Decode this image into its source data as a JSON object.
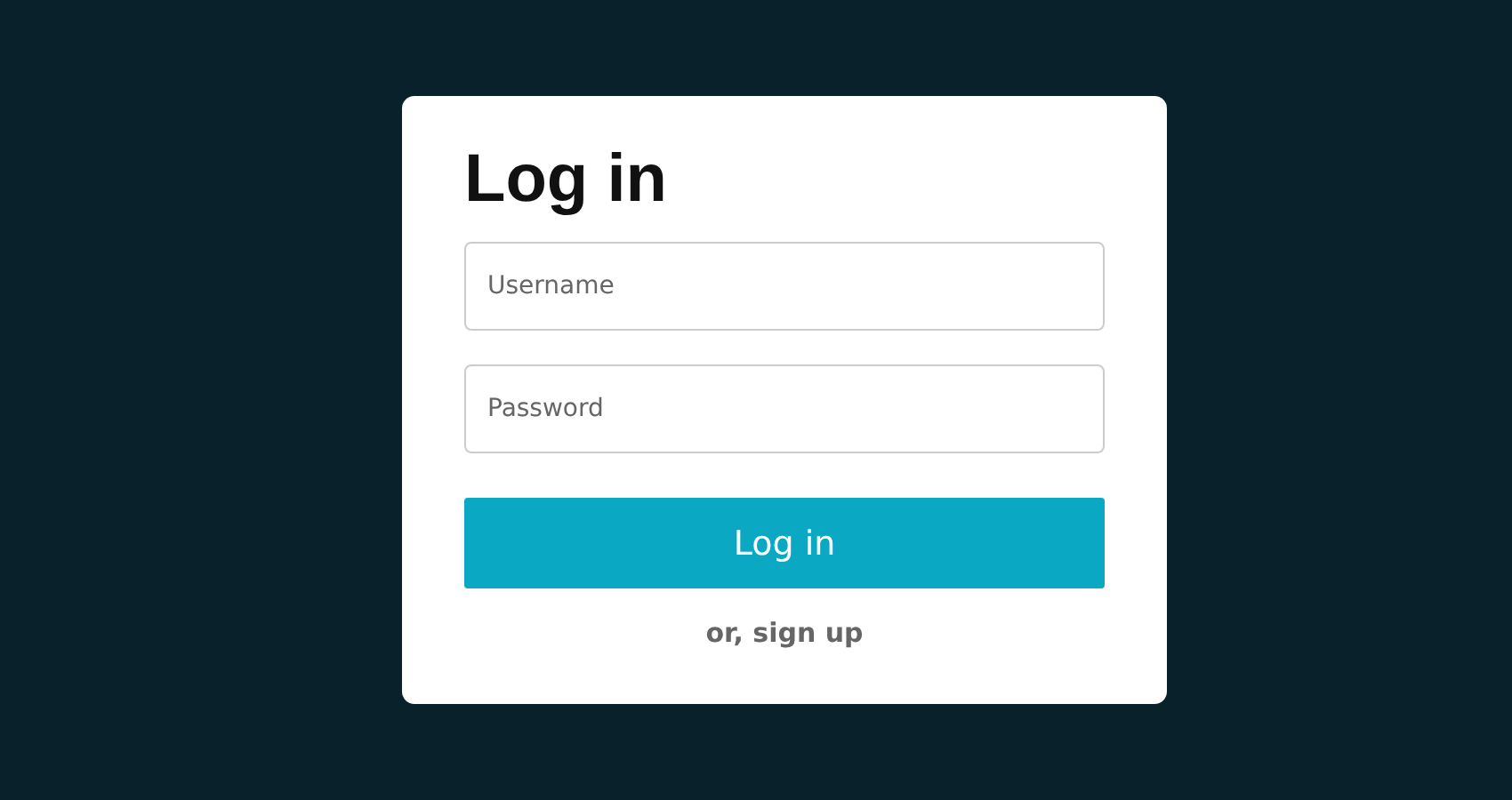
{
  "login": {
    "title": "Log in",
    "fields": [
      {
        "placeholder": "Username"
      },
      {
        "placeholder": "Password"
      }
    ],
    "button": "Log in",
    "signup_link": "or, sign up"
  }
}
